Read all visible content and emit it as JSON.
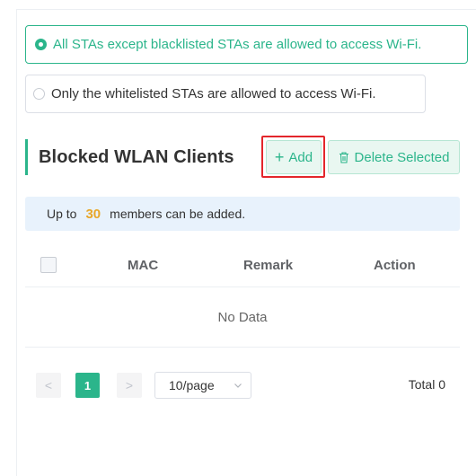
{
  "access_mode": {
    "options": [
      {
        "label": "All STAs except blacklisted STAs are allowed to access Wi-Fi.",
        "selected": true
      },
      {
        "label": "Only the whitelisted STAs are allowed to access Wi-Fi.",
        "selected": false
      }
    ]
  },
  "section": {
    "title": "Blocked WLAN Clients",
    "add_label": "Add",
    "delete_label": "Delete Selected"
  },
  "info": {
    "prefix": "Up to",
    "max_members": "30",
    "suffix": "members can be added."
  },
  "table": {
    "columns": [
      "MAC",
      "Remark",
      "Action"
    ],
    "empty_text": "No Data"
  },
  "pagination": {
    "prev": "<",
    "current_page": "1",
    "next": ">",
    "page_size": "10/page",
    "total": "Total 0"
  },
  "colors": {
    "accent": "#2bb58b",
    "highlight": "#e3262b",
    "info_bg": "#e8f2fc",
    "count": "#e8a628"
  }
}
